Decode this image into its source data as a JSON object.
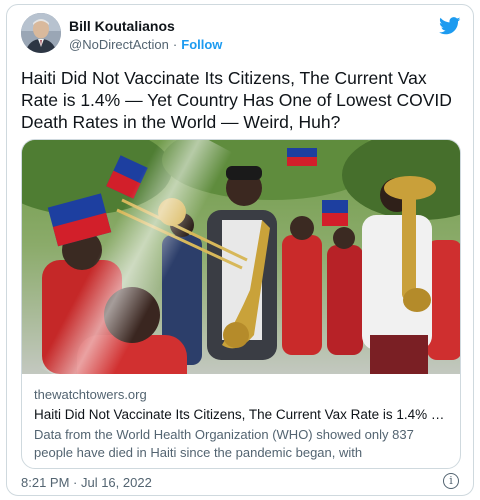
{
  "author": {
    "name": "Bill Koutalianos",
    "handle": "@NoDirectAction",
    "follow_label": "Follow"
  },
  "icons": {
    "logo": "twitter-bird-icon",
    "info": "info-icon",
    "info_glyph": "i"
  },
  "tweet": {
    "text": "Haiti Did Not Vaccinate Its Citizens, The Current Vax Rate is 1.4% — Yet Country Has One of Lowest COVID Death Rates in the World — Weird, Huh?",
    "timestamp": "8:21 PM · Jul 16, 2022"
  },
  "card": {
    "domain": "thewatchtowers.org",
    "title": "Haiti Did Not Vaccinate Its Citizens, The Current Vax Rate is 1.4% — Yet ...",
    "description": "Data from the World Health Organization (WHO) showed only 837 people have died in Haiti since the pandemic began, with"
  },
  "colors": {
    "accent": "#1d9bf0",
    "text": "#0f1419",
    "secondary": "#536471",
    "border": "#cfd9de"
  }
}
